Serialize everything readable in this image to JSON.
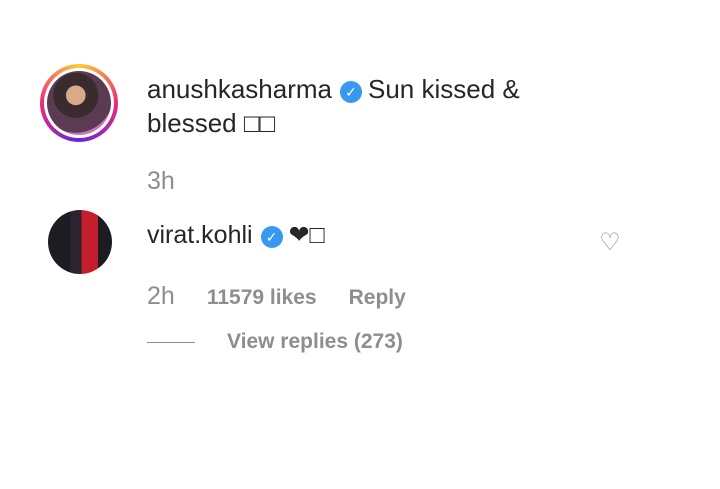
{
  "post": {
    "author": "anushkasharma",
    "caption": "Sun kissed &",
    "caption_line2": "blessed □□",
    "time": "3h"
  },
  "comment": {
    "author": "virat.kohli",
    "text": "❤□",
    "time": "2h",
    "likes": "11579 likes",
    "reply_label": "Reply",
    "view_replies": "View replies (273)"
  },
  "icons": {
    "verified": "verified-badge-icon",
    "like": "heart-outline-icon"
  },
  "colors": {
    "verified": "#3897f0",
    "muted": "#8e8e8e",
    "text": "#262626"
  }
}
